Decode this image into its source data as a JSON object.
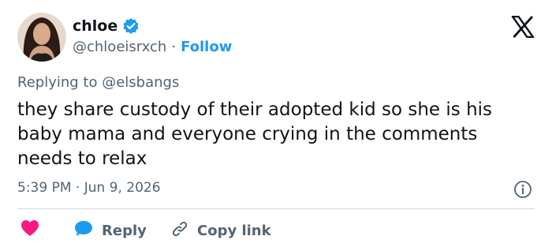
{
  "user": {
    "name": "chloe",
    "handle": "@chloeisrxch",
    "separator": "·",
    "follow_label": "Follow"
  },
  "replying": {
    "prefix": "Replying to ",
    "mention": "@elsbangs"
  },
  "tweet": {
    "text": "they share custody of their adopted kid so she is his baby mama and everyone crying in the comments needs to relax",
    "timestamp": "5:39 PM · Jun 9, 2026"
  },
  "actions": {
    "reply_label": "Reply",
    "copy_label": "Copy link"
  },
  "colors": {
    "accent": "#1d9bf0",
    "heart": "#f91880",
    "muted": "#536471",
    "text": "#0f1419"
  }
}
